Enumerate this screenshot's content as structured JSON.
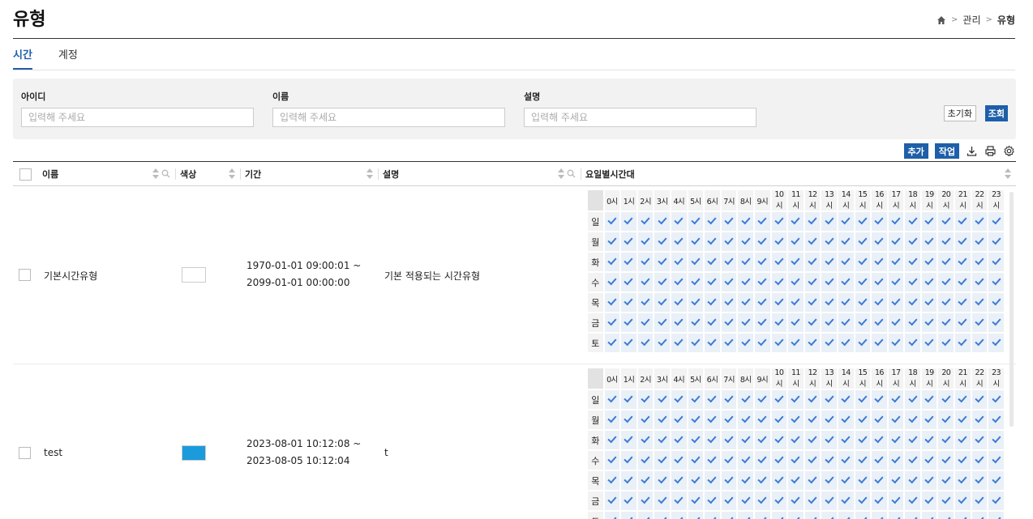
{
  "page": {
    "title": "유형"
  },
  "breadcrumb": {
    "home_icon": "home-icon",
    "items": [
      "관리",
      "유형"
    ],
    "separator": ">"
  },
  "tabs": [
    {
      "label": "시간",
      "active": true
    },
    {
      "label": "계정",
      "active": false
    }
  ],
  "search": {
    "fields": [
      {
        "label": "아이디",
        "placeholder": "입력해 주세요",
        "value": ""
      },
      {
        "label": "이름",
        "placeholder": "입력해 주세요",
        "value": ""
      },
      {
        "label": "설명",
        "placeholder": "입력해 주세요",
        "value": ""
      }
    ],
    "reset_label": "초기화",
    "query_label": "조회"
  },
  "toolbar": {
    "add_label": "추가",
    "work_label": "작업",
    "icons": [
      "download-icon",
      "print-icon",
      "gear-icon"
    ]
  },
  "accent_color": "#1d5fa8",
  "check_color": "#3b7bd6",
  "table": {
    "columns": [
      "이름",
      "색상",
      "기간",
      "설명",
      "요일별시간대"
    ],
    "hours": [
      "0시",
      "1시",
      "2시",
      "3시",
      "4시",
      "5시",
      "6시",
      "7시",
      "8시",
      "9시",
      "10시",
      "11시",
      "12시",
      "13시",
      "14시",
      "15시",
      "16시",
      "17시",
      "18시",
      "19시",
      "20시",
      "21시",
      "22시",
      "23시"
    ],
    "days": [
      "일",
      "월",
      "화",
      "수",
      "목",
      "금",
      "토"
    ],
    "rows": [
      {
        "name": "기본시간유형",
        "color": "#ffffff",
        "period_start": "1970-01-01 09:00:01 ~",
        "period_end": "2099-01-01 00:00:00",
        "description": "기본 적용되는 시간유형",
        "all_checked": true
      },
      {
        "name": "test",
        "color": "#1b9bdc",
        "period_start": "2023-08-01 10:12:08 ~",
        "period_end": "2023-08-05 10:12:04",
        "description": "t",
        "all_checked": true
      }
    ]
  }
}
